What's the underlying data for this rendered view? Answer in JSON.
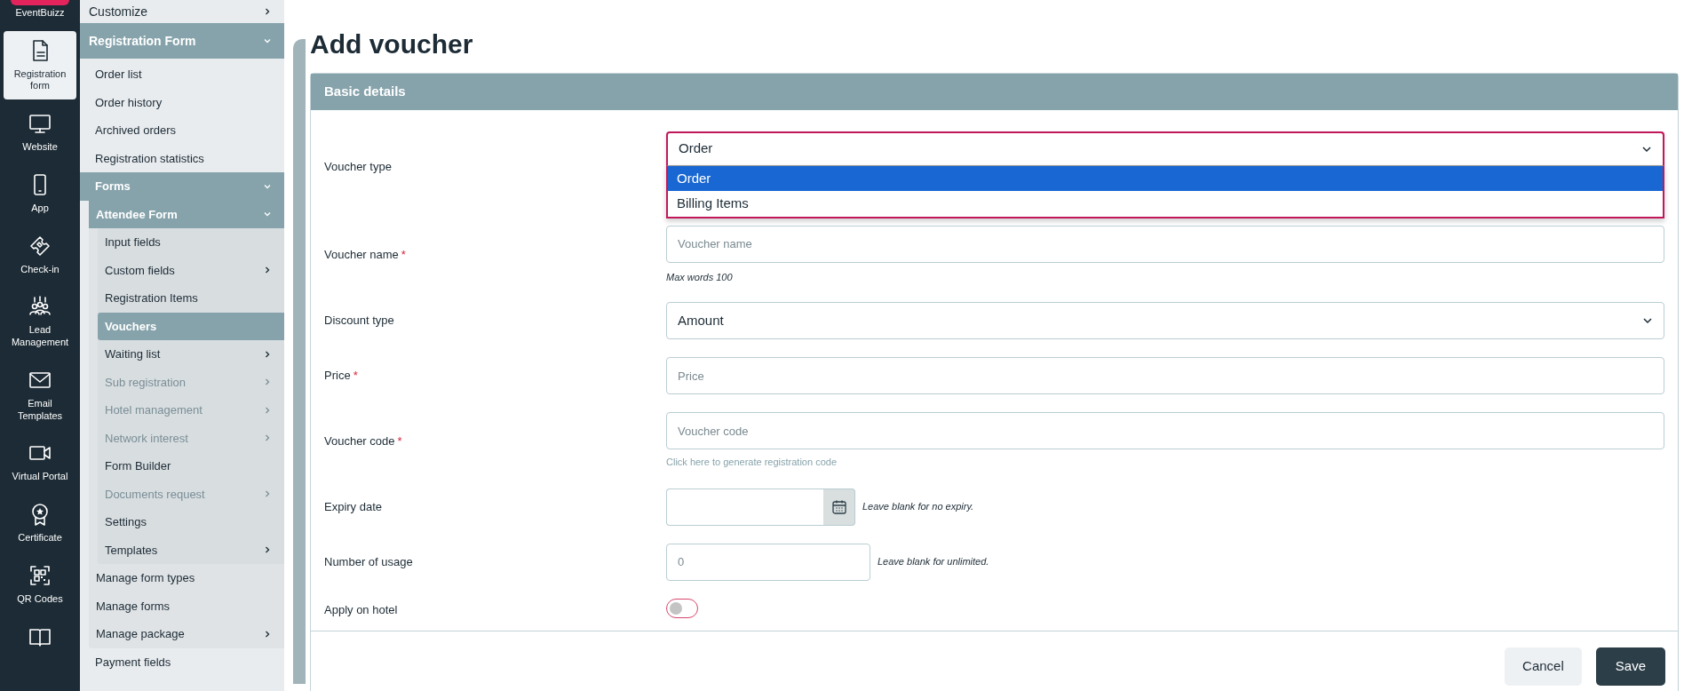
{
  "rail": {
    "logo": "EventBuizz",
    "items": [
      {
        "label": "Registration form",
        "selected": true
      },
      {
        "label": "Website",
        "selected": false
      },
      {
        "label": "App",
        "selected": false
      },
      {
        "label": "Check-in",
        "selected": false
      },
      {
        "label": "Lead Management",
        "selected": false
      },
      {
        "label": "Email Templates",
        "selected": false
      },
      {
        "label": "Virtual Portal",
        "selected": false
      },
      {
        "label": "Certificate",
        "selected": false
      },
      {
        "label": "QR Codes",
        "selected": false
      }
    ]
  },
  "sidebar": {
    "items": [
      {
        "label": "Customize",
        "selected": false,
        "expanded": false
      },
      {
        "label": "Registration Form",
        "selected": false,
        "expanded": true,
        "children": [
          {
            "label": "Order list",
            "selected": false
          },
          {
            "label": "Order history",
            "selected": false
          },
          {
            "label": "Archived orders",
            "selected": false
          },
          {
            "label": "Registration statistics",
            "selected": false
          },
          {
            "label": "Forms",
            "selected": false,
            "expanded": true,
            "children": [
              {
                "label": "Attendee Form",
                "selected": false,
                "expanded": true,
                "children": [
                  {
                    "label": "Input fields",
                    "selected": false,
                    "disabled": false
                  },
                  {
                    "label": "Custom fields",
                    "selected": false,
                    "disabled": false,
                    "expanded": false
                  },
                  {
                    "label": "Registration Items",
                    "selected": false,
                    "disabled": false
                  },
                  {
                    "label": "Vouchers",
                    "selected": true,
                    "disabled": false
                  },
                  {
                    "label": "Waiting list",
                    "selected": false,
                    "disabled": false,
                    "expanded": false
                  },
                  {
                    "label": "Sub registration",
                    "selected": false,
                    "disabled": true,
                    "expanded": false
                  },
                  {
                    "label": "Hotel management",
                    "selected": false,
                    "disabled": true,
                    "expanded": false
                  },
                  {
                    "label": "Network interest",
                    "selected": false,
                    "disabled": true,
                    "expanded": false
                  },
                  {
                    "label": "Form Builder",
                    "selected": false,
                    "disabled": false
                  },
                  {
                    "label": "Documents request",
                    "selected": false,
                    "disabled": true,
                    "expanded": false
                  },
                  {
                    "label": "Settings",
                    "selected": false,
                    "disabled": false
                  },
                  {
                    "label": "Templates",
                    "selected": false,
                    "disabled": false,
                    "expanded": false
                  }
                ]
              },
              {
                "label": "Manage form types",
                "selected": false
              },
              {
                "label": "Manage forms",
                "selected": false
              },
              {
                "label": "Manage package",
                "selected": false,
                "expanded": false
              }
            ]
          },
          {
            "label": "Payment fields",
            "selected": false
          }
        ]
      }
    ]
  },
  "page": {
    "title": "Add voucher",
    "section": "Basic details",
    "fields": [
      {
        "kind": "dropdown",
        "label": "Voucher type",
        "value": "Order",
        "open": true,
        "options": [
          {
            "label": "Order",
            "selected": true
          },
          {
            "label": "Billing Items",
            "selected": false
          }
        ]
      },
      {
        "kind": "text",
        "label": "Voucher name",
        "required": "*",
        "placeholder": "Voucher name",
        "help": "Max words 100"
      },
      {
        "kind": "dropdown",
        "label": "Discount type",
        "value": "Amount",
        "open": false
      },
      {
        "kind": "text",
        "label": "Price",
        "required": "*",
        "placeholder": "Price"
      },
      {
        "kind": "text",
        "label": "Voucher code",
        "required": "*",
        "placeholder": "Voucher code",
        "link": "Click here to generate registration code"
      },
      {
        "kind": "date",
        "label": "Expiry date",
        "hint": "Leave blank for no expiry."
      },
      {
        "kind": "number",
        "label": "Number of usage",
        "placeholder": "0",
        "hint": "Leave blank for unlimited."
      },
      {
        "kind": "toggle",
        "label": "Apply on hotel",
        "on": false
      }
    ],
    "buttons": [
      {
        "label": "Cancel",
        "kind": "secondary"
      },
      {
        "label": "Save",
        "kind": "primary"
      }
    ]
  }
}
